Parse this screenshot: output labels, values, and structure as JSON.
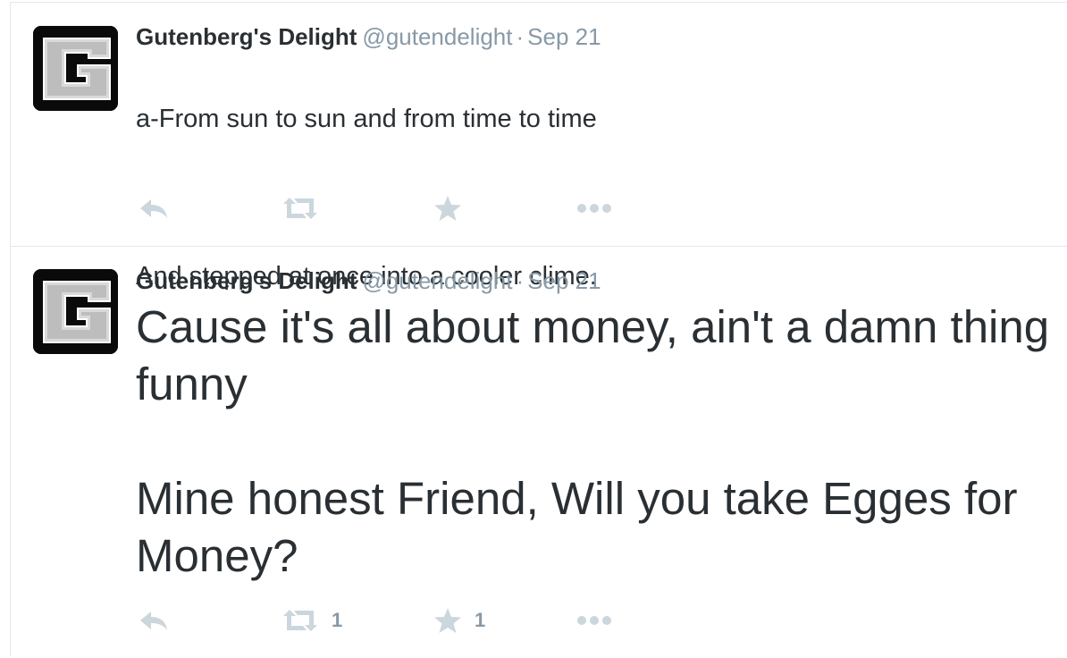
{
  "tweets": [
    {
      "fullname": "Gutenberg's Delight",
      "username": "@gutendelight",
      "separator": "·",
      "time": "Sep 21",
      "text_line1": "a-From sun to sun and from time to time",
      "text_line2": "And stepped at once into a cooler clime.",
      "avatar_letter": "G",
      "retweet_count": "",
      "favorite_count": ""
    },
    {
      "fullname": "Gutenberg's Delight",
      "username": "@gutendelight",
      "separator": "·",
      "time": "Sep 21",
      "text_para1": "Cause it's all about money, ain't a damn thing funny",
      "text_para2": "Mine honest Friend, Will you take Egges for Money?",
      "avatar_letter": "G",
      "retweet_count": "1",
      "favorite_count": "1"
    }
  ],
  "icons": {
    "reply": "reply-icon",
    "retweet": "retweet-icon",
    "favorite": "star-icon",
    "more": "more-icon"
  },
  "colors": {
    "text": "#292f33",
    "meta": "#8899a6",
    "action_icon": "#ccd6dd",
    "border": "#e1e8ed"
  }
}
